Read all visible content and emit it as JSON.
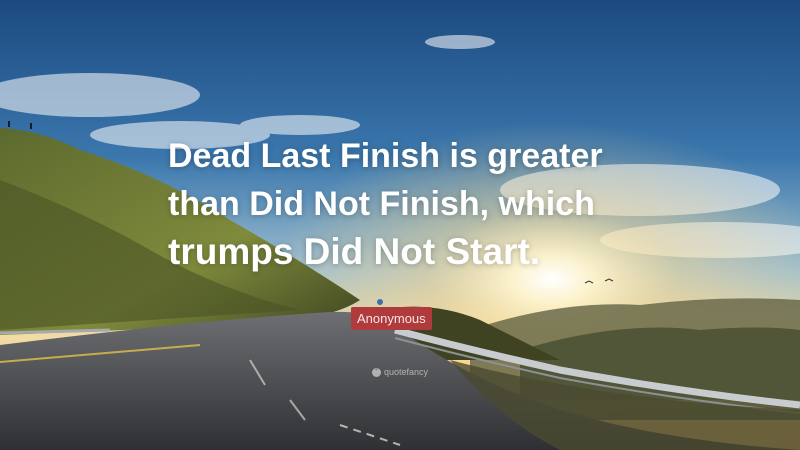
{
  "quote": {
    "line1": "Dead Last Finish is greater",
    "line2": "than Did Not Finish, which",
    "line3": "trumps Did Not Start."
  },
  "author": "Anonymous",
  "watermark": {
    "icon": "quote-mark-icon",
    "glyph": "“",
    "text": "quotefancy"
  },
  "colors": {
    "sky_top": "#1e4f86",
    "sun_glow": "#fff3c8",
    "author_badge": "#b13a3c",
    "text": "#ffffff"
  }
}
